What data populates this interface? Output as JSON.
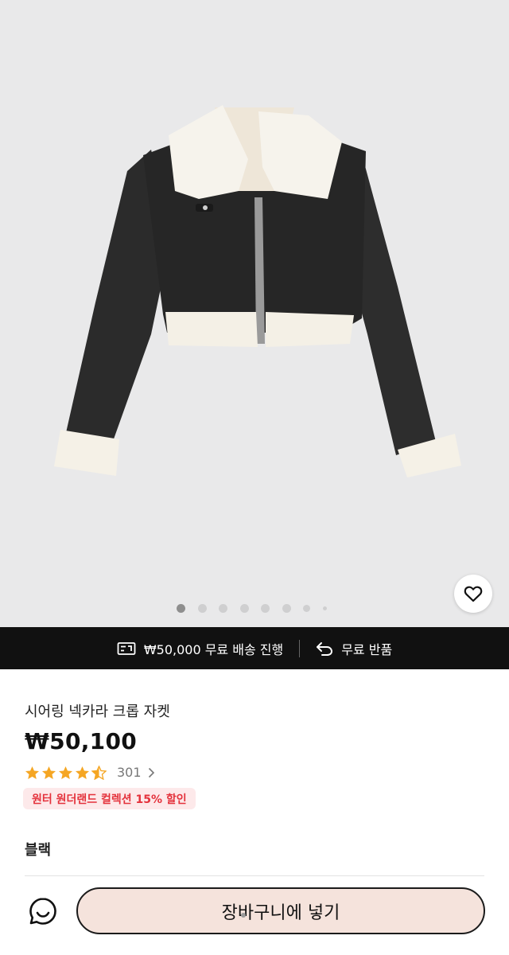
{
  "gallery": {
    "image_alt": "시어링 넥카라 크롭 자켓",
    "dot_count": 8,
    "active_index": 0,
    "wishlist_icon": "heart-outline-icon"
  },
  "promo_bar": {
    "shipping_icon": "free-shipping-icon",
    "shipping_text": "₩50,000 무료 배송 진행",
    "return_icon": "return-arrow-icon",
    "return_text": "무료 반품"
  },
  "product": {
    "title": "시어링 넥카라 크롭 자켓",
    "price": "₩50,100",
    "rating_value": 4.5,
    "rating_star_color": "#f5a623",
    "review_count": "301",
    "promo_badge": "원터 원더랜드 컬렉션 15% 할인",
    "promo_badge_color": "#e4323c",
    "color_label": "블랙"
  },
  "bottom_bar": {
    "chat_icon": "chat-bubble-icon",
    "add_to_cart_label": "장바구니에 넣기",
    "cart_button_bg": "#f5e3dc"
  }
}
